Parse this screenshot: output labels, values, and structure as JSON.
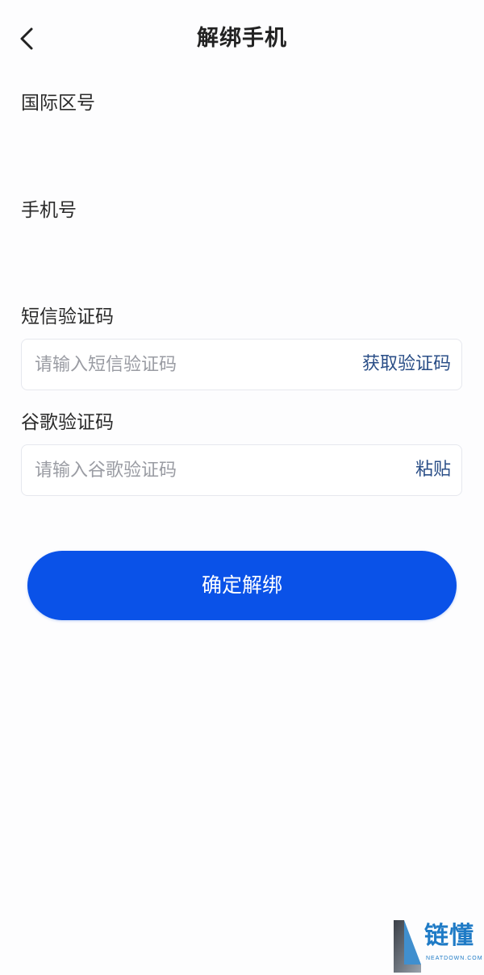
{
  "header": {
    "title": "解绑手机",
    "back_icon": "chevron-left-icon"
  },
  "form": {
    "country_code": {
      "label": "国际区号",
      "value": ""
    },
    "phone": {
      "label": "手机号",
      "value": ""
    },
    "sms_code": {
      "label": "短信验证码",
      "placeholder": "请输入短信验证码",
      "action_label": "获取验证码"
    },
    "google_code": {
      "label": "谷歌验证码",
      "placeholder": "请输入谷歌验证码",
      "action_label": "粘贴"
    }
  },
  "confirm_button": {
    "label": "确定解绑"
  },
  "watermark": {
    "name": "链懂",
    "domain": "NEATDOWN.COM"
  },
  "colors": {
    "primary": "#0a52e8",
    "link": "#2a4e87",
    "background": "#fdfdfe"
  }
}
